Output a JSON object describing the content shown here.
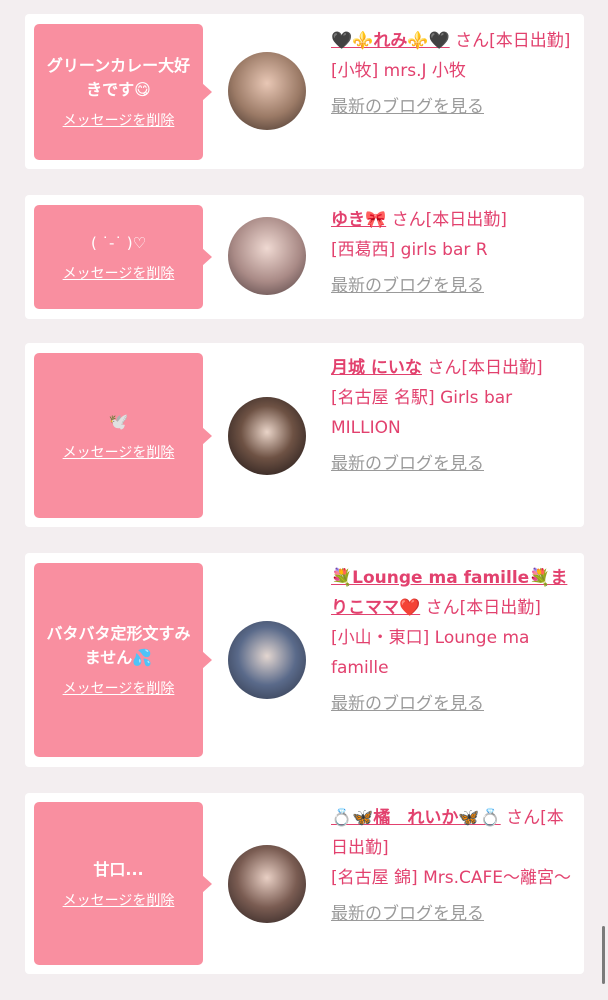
{
  "cards": [
    {
      "message": "グリーンカレー大好きです😋",
      "delete_label": "メッセージを削除",
      "name": "🖤⚜️れみ⚜️🖤",
      "suffix": "さん[本日出勤]",
      "shop": "[小牧] mrs.J 小牧",
      "blog_label": "最新のブログを見る"
    },
    {
      "message": "( ˙-˙ )♡",
      "delete_label": "メッセージを削除",
      "name": "ゆき🎀",
      "suffix": "さん[本日出勤]",
      "shop": "[西葛西] girls bar R",
      "blog_label": "最新のブログを見る"
    },
    {
      "message": "🕊️",
      "delete_label": "メッセージを削除",
      "name": "月城 にいな",
      "suffix": "さん[本日出勤]",
      "shop": "[名古屋 名駅] Girls bar MILLION",
      "blog_label": "最新のブログを見る"
    },
    {
      "message": "バタバタ定形文すみません💦",
      "delete_label": "メッセージを削除",
      "name": "💐Lounge ma famille💐まりこママ❤️",
      "suffix": "さん[本日出勤]",
      "shop": "[小山・東口] Lounge ma famille",
      "blog_label": "最新のブログを見る"
    },
    {
      "message": "甘口...",
      "delete_label": "メッセージを削除",
      "name": "💍🦋橘　れいか🦋💍",
      "suffix": "さん[本日出勤]",
      "shop": "[名古屋 錦] Mrs.CAFE〜離宮〜",
      "blog_label": "最新のブログを見る"
    }
  ]
}
